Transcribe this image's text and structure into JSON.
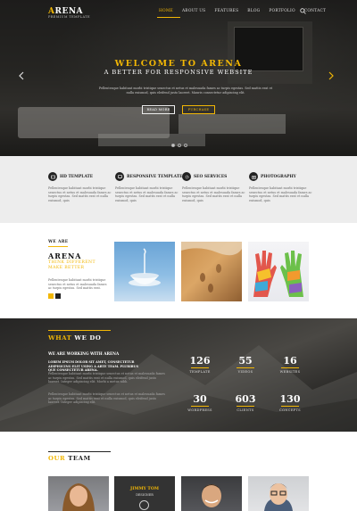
{
  "header": {
    "logo": {
      "first_letter": "A",
      "rest": "RENA",
      "subtitle": "PREMIUM TEMPLATE"
    },
    "menu": [
      "HOME",
      "ABOUT US",
      "FEATURES",
      "BLOG",
      "PORTFOLIO",
      "CONTACT"
    ],
    "active_menu": "HOME"
  },
  "hero": {
    "title": "WELCOME TO ARENA",
    "subtitle": "A BETTER FOR RESPONSIVE WEBSITE",
    "text": "Pellentesque habitant morbi tristique senectus et netus et malesuada fames ac turpis egestas. Sed mattis erat et nulla euismod, quis eleifend justo laoreet. Mauris consectetur adipiscing elit.",
    "read_more": "READ MORE",
    "purchase": "PURCHASE",
    "slides": 3,
    "active_slide": 1
  },
  "features": [
    {
      "icon": "hd-icon",
      "title": "HD TEMPLATE",
      "text": "Pellentesque habitant morbi tristique senectus et netus et malesuada fames ac turpis egestas. Sed mattis erat et nulla euismod, quis"
    },
    {
      "icon": "monitor-icon",
      "title": "RESPONSIVE TEMPLATE",
      "text": "Pellentesque habitant morbi tristique senectus et netus et malesuada fames ac turpis egestas. Sed mattis erat et nulla euismod, quis"
    },
    {
      "icon": "gear-icon",
      "title": "SEO SERVICES",
      "text": "Pellentesque habitant morbi tristique senectus et netus et malesuada fames ac turpis egestas. Sed mattis erat et nulla euismod, quis"
    },
    {
      "icon": "camera-icon",
      "title": "PHOTOGRAPHY",
      "text": "Pellentesque habitant morbi tristique senectus et netus et malesuada fames ac turpis egestas. Sed mattis erat et nulla euismod, quis"
    }
  ],
  "about": {
    "label": "WE ARE",
    "title": "ARENA",
    "tagline_1": "THINK DIFFERENT",
    "tagline_2": "MAKE BETTER",
    "text": "Pellentesque habitant morbi tristique senectus et netus et malesuada fames ac turpis egestas. Sed mattis erat."
  },
  "what_we_do": {
    "title_highlight": "WHAT",
    "title_rest": " WE DO",
    "heading": "WE ARE WORKING WITH ARENA",
    "lead": "LOREM IPSUM DOLOR SIT AMET, CONSECTETUR ADIPISICING ELIT USING A ARTE TEAM. PLURIBUS QUE CONSECTETUR ARENA.",
    "p1": "Pellentesque habitant morbi tristique senectus et netus et malesuada fames ac turpis egestas. Sed mattis erat et nulla euismod, quis eleifend justo laoreet. Integer adipiscing elit. Morbi a metus nibh.",
    "p2": "Pellentesque habitant morbi tristique senectus et netus et malesuada fames ac turpis egestas. Sed mattis erat et nulla euismod, quis eleifend justo laoreet. Integer adipiscing elit.",
    "stats": [
      {
        "value": "126",
        "label": "TEMPLATE"
      },
      {
        "value": "55",
        "label": "VIDEOS"
      },
      {
        "value": "16",
        "label": "WEBSITES"
      },
      {
        "value": "30",
        "label": "WORDPRESS"
      },
      {
        "value": "603",
        "label": "CLIENTS"
      },
      {
        "value": "130",
        "label": "CONCEPTS"
      }
    ]
  },
  "team": {
    "title_highlight": "OUR",
    "title_rest": " TEAM",
    "featured_name": "JIMMY TOM",
    "featured_role": "DESIGNER"
  },
  "colors": {
    "accent": "#f2b705",
    "dark": "#222222",
    "light_band": "#ededed"
  }
}
